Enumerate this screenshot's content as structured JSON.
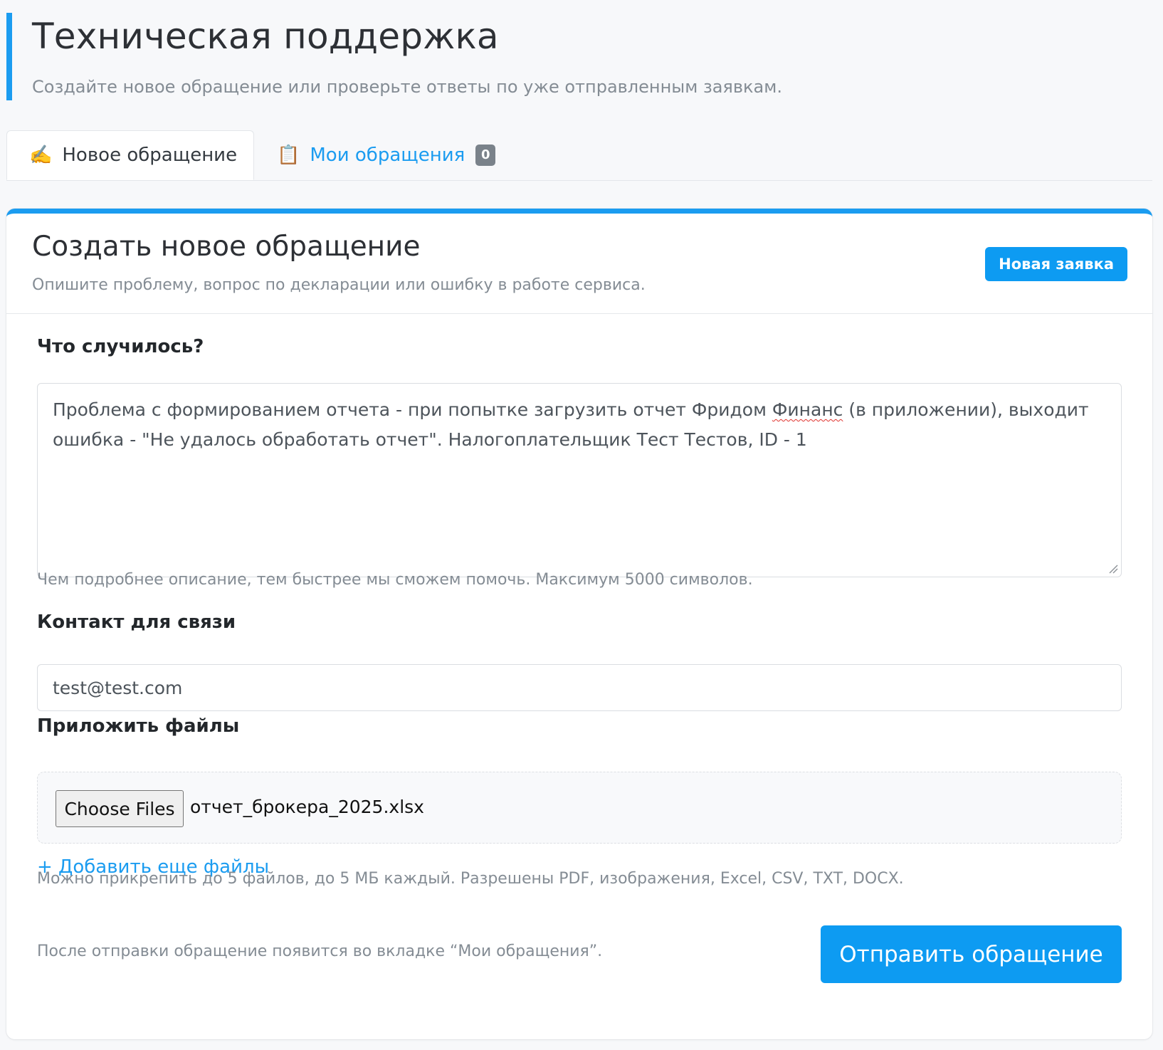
{
  "header": {
    "title": "Техническая поддержка",
    "subtitle": "Создайте новое обращение или проверьте ответы по уже отправленным заявкам."
  },
  "tabs": [
    {
      "icon": "writing-hand-icon",
      "icon_glyph": "✍️",
      "label": "Новое обращение",
      "active": true
    },
    {
      "icon": "clipboard-icon",
      "icon_glyph": "📋",
      "label": "Мои обращения",
      "badge": "0",
      "active": false
    }
  ],
  "card": {
    "title": "Создать новое обращение",
    "subtitle": "Опишите проблему, вопрос по декларации или ошибку в работе сервиса.",
    "new_ticket_button": "Новая заявка"
  },
  "form": {
    "description": {
      "label": "Что случилось?",
      "value_before": "Проблема с формированием отчета - при попытке загрузить отчет Фридом ",
      "value_misspelled": "Финанс",
      "value_after": " (в приложении), выходит ошибка - \"Не удалось обработать отчет\". Налогоплательщик Тест Тестов, ID - 1",
      "help": "Чем подробнее описание, тем быстрее мы сможем помочь. Максимум 5000 символов."
    },
    "contact": {
      "label": "Контакт для связи",
      "value": "test@test.com"
    },
    "files": {
      "label": "Приложить файлы",
      "choose_button": "Choose Files",
      "selected_file": "отчет_брокера_2025.xlsx",
      "add_more": "+ Добавить еще файлы",
      "help": "Можно прикрепить до 5 файлов, до 5 МБ каждый. Разрешены PDF, изображения, Excel, CSV, TXT, DOCX."
    },
    "footer_note": "После отправки обращение появится во вкладке “Мои обращения”.",
    "submit_button": "Отправить обращение"
  },
  "colors": {
    "accent": "#1b9cf0",
    "primary_button": "#0d9bf2",
    "muted_text": "#848c94",
    "badge": "#7a828a",
    "spellcheck": "#e0312c"
  }
}
